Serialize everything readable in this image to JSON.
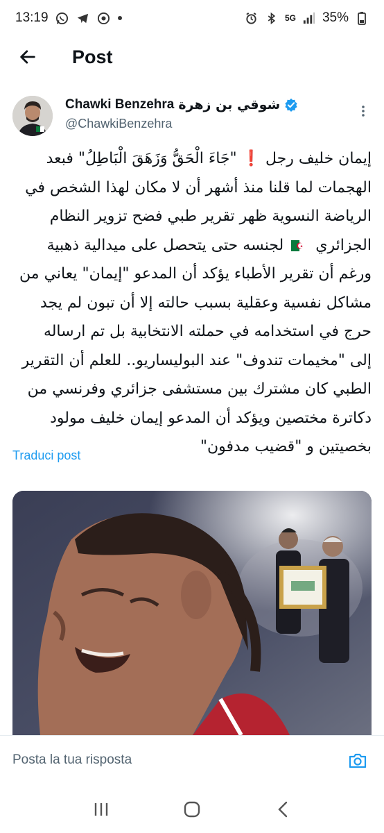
{
  "status_bar": {
    "time": "13:19",
    "network": "5G",
    "battery": "35%"
  },
  "header": {
    "title": "Post"
  },
  "author": {
    "display_name": "Chawki Benzehra",
    "display_name_arabic": "شوقي بن زهرة",
    "handle": "@ChawkiBenzehra",
    "verified": true
  },
  "post": {
    "lines": [
      "إيمان خليف رجل ❗ \"جَاءَ الْحَقُّ وَزَهَقَ الْبَاطِلُ\" فبعد",
      "الهجمات لما قلنا منذ أشهر أن لا مكان لهذا الشخص في",
      "الرياضة النسوية ظهر تقرير طبي فضح تزوير النظام",
      "الجزائري",
      "لجنسه حتى يتحصل على ميدالية ذهبية",
      "ورغم أن تقرير الأطباء يؤكد أن المدعو \"إيمان\" يعاني من",
      "مشاكل نفسية وعقلية بسبب حالته إلا أن تبون لم يجد",
      "حرج في استخدامه في حملته الانتخابية بل تم ارساله",
      "إلى \"مخيمات تندوف\" عند البوليساريو.. للعلم أن التقرير",
      "الطبي كان مشترك بين مستشفى جزائري وفرنسي من",
      "دكاترة مختصين ويؤكد أن المدعو إيمان خليف مولود",
      "بخصيتين و \"قضيب مدفون\""
    ],
    "translate_label": "Traduci post"
  },
  "reply": {
    "placeholder": "Posta la tua risposta"
  },
  "colors": {
    "accent": "#1d9bf0",
    "verified": "#1d9bf0",
    "secondary_text": "#536471"
  }
}
